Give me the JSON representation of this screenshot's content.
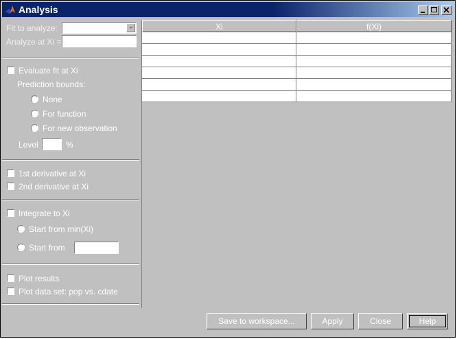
{
  "window": {
    "title": "Analysis"
  },
  "left": {
    "fit_label": "Fit to analyze:",
    "fit_value": "",
    "xi_label": "Analyze at Xi =",
    "xi_value": "",
    "evaluate_label": "Evaluate fit at Xi",
    "pred_bounds_label": "Prediction bounds:",
    "pb_none": "None",
    "pb_function": "For function",
    "pb_newobs": "For new observation",
    "level_label": "Level",
    "level_value": "",
    "level_unit": "%",
    "deriv1": "1st derivative at Xi",
    "deriv2": "2nd derivative at Xi",
    "integrate": "Integrate to Xi",
    "start_min": "Start from min(Xi)",
    "start_from": "Start from",
    "start_value": "",
    "plot_results": "Plot results",
    "plot_dataset": "Plot data set: pop vs. cdate"
  },
  "table": {
    "columns": [
      "Xi",
      "f(Xi)"
    ],
    "rows": [
      [
        "",
        ""
      ],
      [
        "",
        ""
      ],
      [
        "",
        ""
      ],
      [
        "",
        ""
      ],
      [
        "",
        ""
      ],
      [
        "",
        ""
      ]
    ]
  },
  "buttons": {
    "save": "Save to workspace...",
    "apply": "Apply",
    "close": "Close",
    "help": "Help"
  }
}
